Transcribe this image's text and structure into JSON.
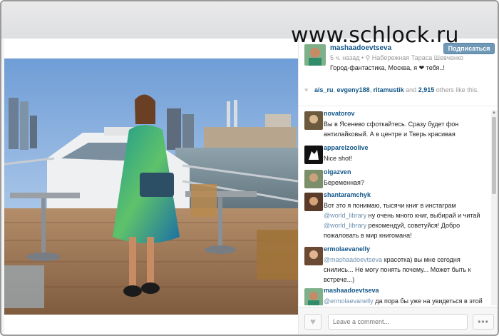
{
  "watermark": "www.schlock.ru",
  "post": {
    "username": "mashaadoevtseva",
    "time": "5 ч. назад",
    "location": "Набережная Тараса Шевченко",
    "caption": "Город-фантастика, Москва, я ❤ тебя..!",
    "subscribe_label": "Подписаться"
  },
  "likes": {
    "user1": "ais_ru",
    "user2": "evgeny188",
    "user3": "ritamustik",
    "and": "and",
    "count": "2,915",
    "suffix": "others like this."
  },
  "comments": [
    {
      "user": "novatorov",
      "text": "Вы в Ясенево сфоткайтесь. Сразу будет фон антилайковый. А в центре и Тверь красивая"
    },
    {
      "user": "apparelzoolive",
      "text": "Nice shot!"
    },
    {
      "user": "olgazven",
      "text": "Беременная?"
    },
    {
      "user": "shantaramchyk",
      "text_pre": "Вот это я понимаю, тысячи книг в инстаграм",
      "mention1": "@world_library",
      "text_mid": "ну очень много книг, выбирай и читай",
      "mention2": "@world_library",
      "text_post": "рекомендуй, советуйся! Добро пожаловать в мир книгомана!"
    },
    {
      "user": "ermolaevanelly",
      "mention": "@mashaadoevtseva",
      "text": "красотка) вы мне сегодня снились... Не могу понять почему... Может быть к встрече...)"
    },
    {
      "user": "mashaadoevtseva",
      "mention": "@ermolaevanelly",
      "text": "да пора бы уже на увидеться в этой жизни)) Ты когда из лос кам бэк!))"
    }
  ],
  "footer": {
    "like_icon": "♥",
    "comment_placeholder": "Leave a comment...",
    "more_label": "•••"
  },
  "icons": {
    "pin": "location-pin-icon",
    "heart": "heart-icon"
  },
  "colors": {
    "link": "#125688",
    "mention": "#6f91b0",
    "button": "#6f97b6"
  }
}
